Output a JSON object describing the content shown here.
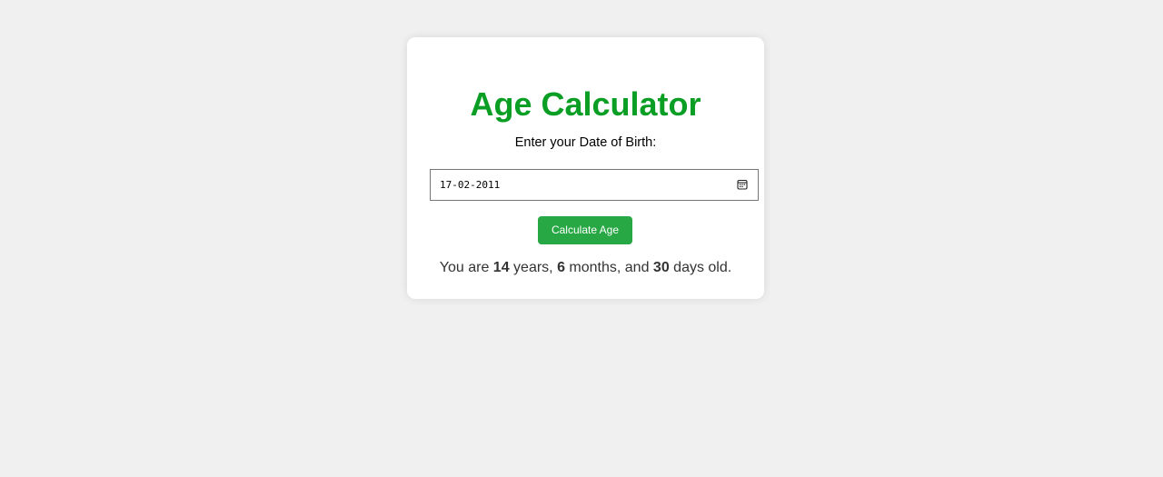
{
  "app": {
    "title": "Age Calculator",
    "prompt": "Enter your Date of Birth:",
    "date_value": "17-02-2011",
    "button_label": "Calculate Age"
  },
  "result": {
    "prefix": "You are ",
    "years": "14",
    "years_label": " years, ",
    "months": "6",
    "months_label": " months, and ",
    "days": "30",
    "days_label": " days old."
  },
  "colors": {
    "title": "#0a9e24",
    "button": "#28a745",
    "background": "#f0f0f0"
  },
  "icons": {
    "date_picker": "calendar-icon"
  }
}
